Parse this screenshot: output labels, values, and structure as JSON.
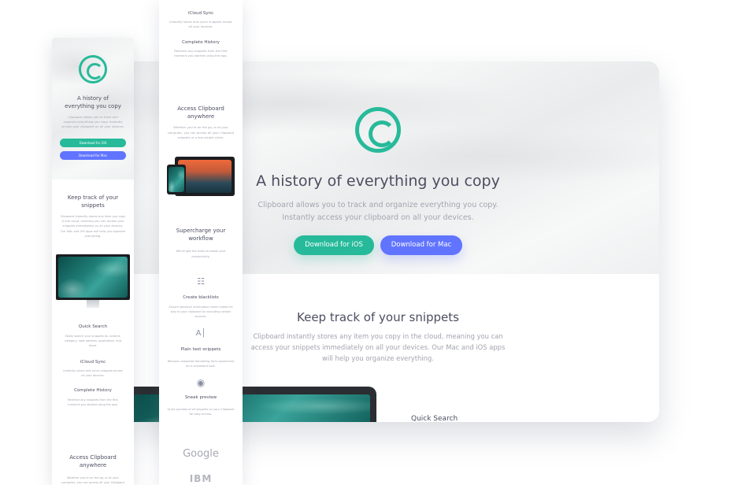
{
  "brand": {
    "accent_green": "#26ba9a",
    "accent_blue": "#6174ff",
    "heading_color": "#4c4e61",
    "body_color": "#a3a5b0"
  },
  "hero": {
    "title": "A history of everything you copy",
    "title_mobile_line1": "A history of",
    "title_mobile_line2": "everything you copy",
    "description": "Clipboard allows you to track and organize everything you copy. Instantly access your clipboard on all your devices.",
    "ios_button": "Download for iOS",
    "mac_button": "Download for Mac"
  },
  "snippets": {
    "title": "Keep track of your snippets",
    "description": "Clipboard instantly stores any item you copy in the cloud, meaning you can access your snippets immediately on all your devices. Our Mac and iOS apps will help you organize everything."
  },
  "features": [
    {
      "title": "Quick Search",
      "text": "Easily search your snippets by content, category, web address, application, and more."
    },
    {
      "title": "iCloud Sync",
      "text": "Instantly saves and syncs snippets across all your devices."
    },
    {
      "title": "Complete History",
      "text": "Retrieve any snippets from the first moment you started using the app."
    }
  ],
  "access": {
    "title": "Access Clipboard anywhere",
    "description": "Whether you're on the go, or at your computer, you can access all your Clipboard snippets in a few simple clicks."
  },
  "workflow": {
    "title": "Supercharge your workflow",
    "description": "We've got the tools to boost your productivity.",
    "items": [
      {
        "icon": "blacklist-icon",
        "title": "Create blacklists",
        "text": "Ensure sensitive information never makes its way to your clipboard by excluding certain sources."
      },
      {
        "icon": "text-icon",
        "title": "Plain text snippets",
        "text": "Remove unwanted formatting from copied text for a consistent look."
      },
      {
        "icon": "eye-icon",
        "title": "Sneak preview",
        "text": "Quick preview of all snippets on your Clipboard for easy access."
      }
    ]
  },
  "partners": [
    "Google",
    "IBM"
  ]
}
